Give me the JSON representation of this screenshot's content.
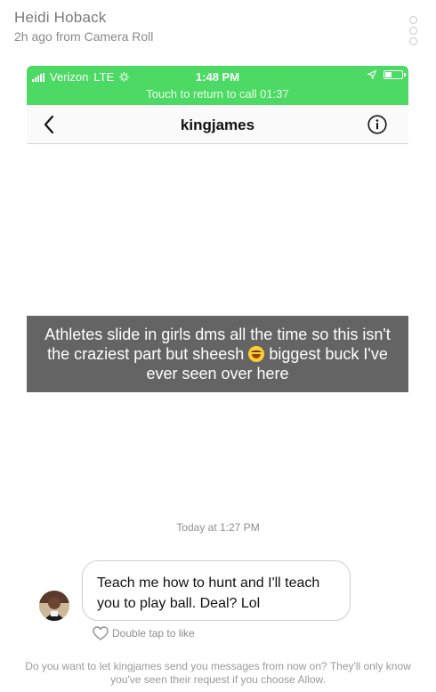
{
  "snap": {
    "sender_name": "Heidi Hoback",
    "subtitle": "2h ago from Camera Roll"
  },
  "status_bar": {
    "carrier": "Verizon",
    "network": "LTE",
    "time": "1:48 PM",
    "call_banner": "Touch to return to call 01:37",
    "accent_color": "#4cd964"
  },
  "nav": {
    "title": "kingjames",
    "back_icon": "chevron-left-icon",
    "info_icon": "info-icon"
  },
  "caption": {
    "line_before_emoji": "Athletes slide in girls dms all the time so this isn't the craziest part but sheesh",
    "line_after_emoji": "biggest buck I've ever seen over here",
    "emoji_icon": "laughing-emoji-icon"
  },
  "chat": {
    "timestamp": "Today at 1:27 PM",
    "message": "Teach me how to hunt and I'll teach you to play ball. Deal? Lol",
    "like_label": "Double tap to like",
    "request_note": "Do you want to let kingjames send you messages from now on? They'll only know you've seen their request if you choose Allow."
  }
}
